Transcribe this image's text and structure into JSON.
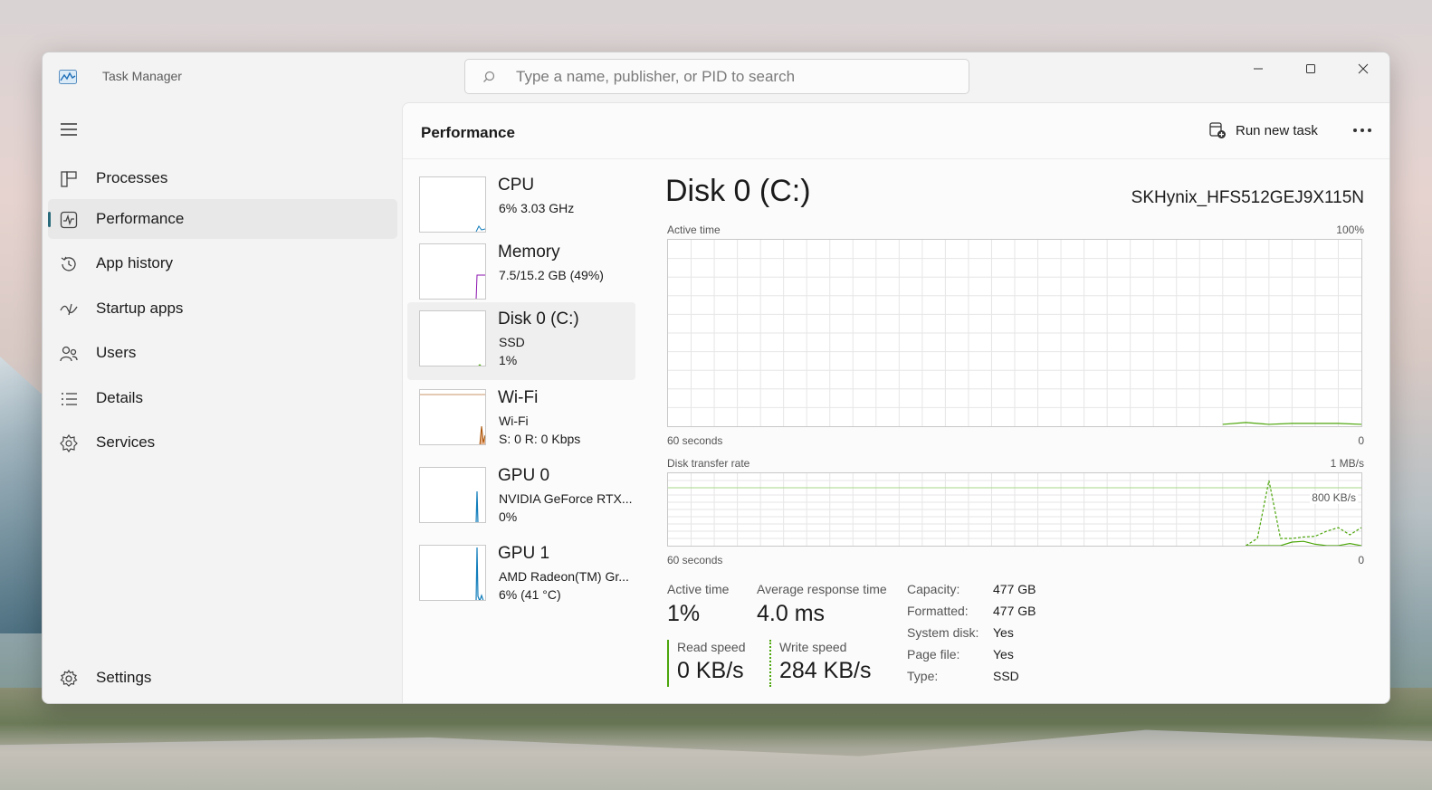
{
  "window": {
    "title": "Task Manager"
  },
  "search": {
    "placeholder": "Type a name, publisher, or PID to search",
    "value": ""
  },
  "nav": {
    "items": [
      {
        "label": "Processes",
        "icon": "processes-icon"
      },
      {
        "label": "Performance",
        "icon": "performance-icon",
        "active": true
      },
      {
        "label": "App history",
        "icon": "history-icon"
      },
      {
        "label": "Startup apps",
        "icon": "startup-icon"
      },
      {
        "label": "Users",
        "icon": "users-icon"
      },
      {
        "label": "Details",
        "icon": "details-icon"
      },
      {
        "label": "Services",
        "icon": "services-icon"
      }
    ],
    "settings": {
      "label": "Settings",
      "icon": "gear-icon"
    }
  },
  "header": {
    "title": "Performance",
    "run_task_label": "Run new task"
  },
  "devices": [
    {
      "name": "CPU",
      "sub1": "6%  3.03 GHz",
      "sub2": "",
      "color": "#117dbb"
    },
    {
      "name": "Memory",
      "sub1": "7.5/15.2 GB (49%)",
      "sub2": "",
      "color": "#8b12ae"
    },
    {
      "name": "Disk 0 (C:)",
      "sub1": "SSD",
      "sub2": "1%",
      "color": "#4da60c",
      "active": true
    },
    {
      "name": "Wi-Fi",
      "sub1": "Wi-Fi",
      "sub2": "S: 0  R: 0 Kbps",
      "color": "#a74f01"
    },
    {
      "name": "GPU 0",
      "sub1": "NVIDIA GeForce RTX...",
      "sub2": "0%",
      "color": "#117dbb"
    },
    {
      "name": "GPU 1",
      "sub1": "AMD Radeon(TM) Gr...",
      "sub2": "6%  (41 °C)",
      "color": "#117dbb"
    }
  ],
  "disk": {
    "title": "Disk 0 (C:)",
    "model": "SKHynix_HFS512GEJ9X115N",
    "active_chart": {
      "label": "Active time",
      "max_label": "100%",
      "time_label": "60 seconds",
      "min_label": "0"
    },
    "transfer_chart": {
      "label": "Disk transfer rate",
      "max_label": "1 MB/s",
      "mid_label": "800 KB/s",
      "time_label": "60 seconds",
      "min_label": "0"
    },
    "stats": {
      "active_time_label": "Active time",
      "active_time_value": "1%",
      "avg_response_label": "Average response time",
      "avg_response_value": "4.0 ms",
      "read_label": "Read speed",
      "read_value": "0 KB/s",
      "write_label": "Write speed",
      "write_value": "284 KB/s"
    },
    "properties": [
      {
        "label": "Capacity:",
        "value": "477 GB"
      },
      {
        "label": "Formatted:",
        "value": "477 GB"
      },
      {
        "label": "System disk:",
        "value": "Yes"
      },
      {
        "label": "Page file:",
        "value": "Yes"
      },
      {
        "label": "Type:",
        "value": "SSD"
      }
    ],
    "accent_color": "#4da60c"
  },
  "chart_data": [
    {
      "type": "line",
      "title": "Active time",
      "ylabel": "",
      "ylim": [
        0,
        100
      ],
      "x": [
        48,
        50,
        52,
        54,
        56,
        58,
        60
      ],
      "series": [
        {
          "values": [
            1,
            2,
            1,
            1.5,
            1.5,
            1.5,
            1
          ]
        }
      ]
    },
    {
      "type": "line",
      "title": "Disk transfer rate",
      "ylim": [
        0,
        1000
      ],
      "x": [
        50,
        51,
        52,
        53,
        54,
        55,
        56,
        57,
        58,
        59,
        60
      ],
      "series": [
        {
          "values": [
            0,
            100,
            900,
            100,
            100,
            120,
            130,
            200,
            250,
            150,
            250
          ]
        },
        {
          "values": [
            0,
            0,
            0,
            0,
            50,
            60,
            20,
            0,
            0,
            30,
            0
          ]
        }
      ]
    }
  ]
}
